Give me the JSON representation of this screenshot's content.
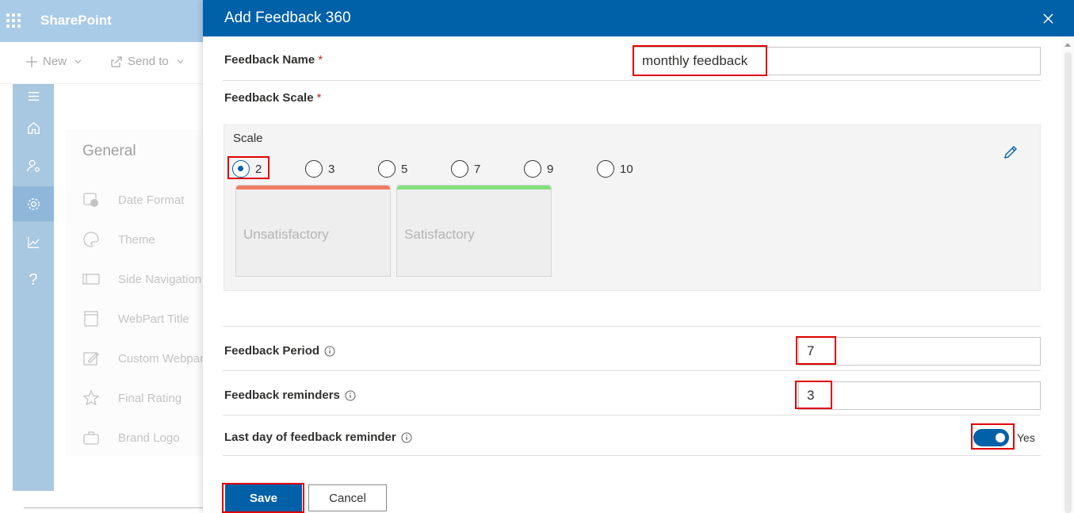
{
  "background": {
    "brand": "SharePoint",
    "commands": [
      {
        "label": "New",
        "icon": "plus-icon"
      },
      {
        "label": "Send to",
        "icon": "share-icon"
      }
    ],
    "rail_icons": [
      "hamburger-icon",
      "home-icon",
      "users-settings-icon",
      "gear-icon",
      "chart-icon",
      "help-icon"
    ],
    "help_glyph": "?",
    "section_title": "General",
    "settings": [
      {
        "label": "Date Format",
        "icon": "calendar-clock-icon"
      },
      {
        "label": "Theme",
        "icon": "palette-icon"
      },
      {
        "label": "Side Navigation",
        "icon": "side-nav-icon"
      },
      {
        "label": "WebPart Title",
        "icon": "webpart-icon"
      },
      {
        "label": "Custom Webpart",
        "icon": "edit-doc-icon"
      },
      {
        "label": "Final Rating",
        "icon": "star-icon"
      },
      {
        "label": "Brand Logo",
        "icon": "briefcase-icon"
      }
    ]
  },
  "dialog": {
    "title": "Add Feedback 360",
    "close_icon": "close-icon",
    "feedback_name": {
      "label": "Feedback Name",
      "required_mark": "*",
      "value": "monthly feedback"
    },
    "feedback_scale": {
      "label": "Feedback Scale",
      "required_mark": "*",
      "scale_title": "Scale",
      "options": [
        "2",
        "3",
        "5",
        "7",
        "9",
        "10"
      ],
      "selected": "2",
      "levels": [
        {
          "label": "Unsatisfactory",
          "color": "#f07a64"
        },
        {
          "label": "Satisfactory",
          "color": "#82e07a"
        }
      ]
    },
    "feedback_period": {
      "label": "Feedback Period",
      "value": "7"
    },
    "feedback_reminders": {
      "label": "Feedback reminders",
      "value": "3"
    },
    "last_day_reminder": {
      "label": "Last day of feedback reminder",
      "toggle_text": "Yes",
      "on": true
    },
    "buttons": {
      "save": "Save",
      "cancel": "Cancel"
    }
  },
  "colors": {
    "accent": "#0060a8",
    "highlight": "#e00000"
  }
}
